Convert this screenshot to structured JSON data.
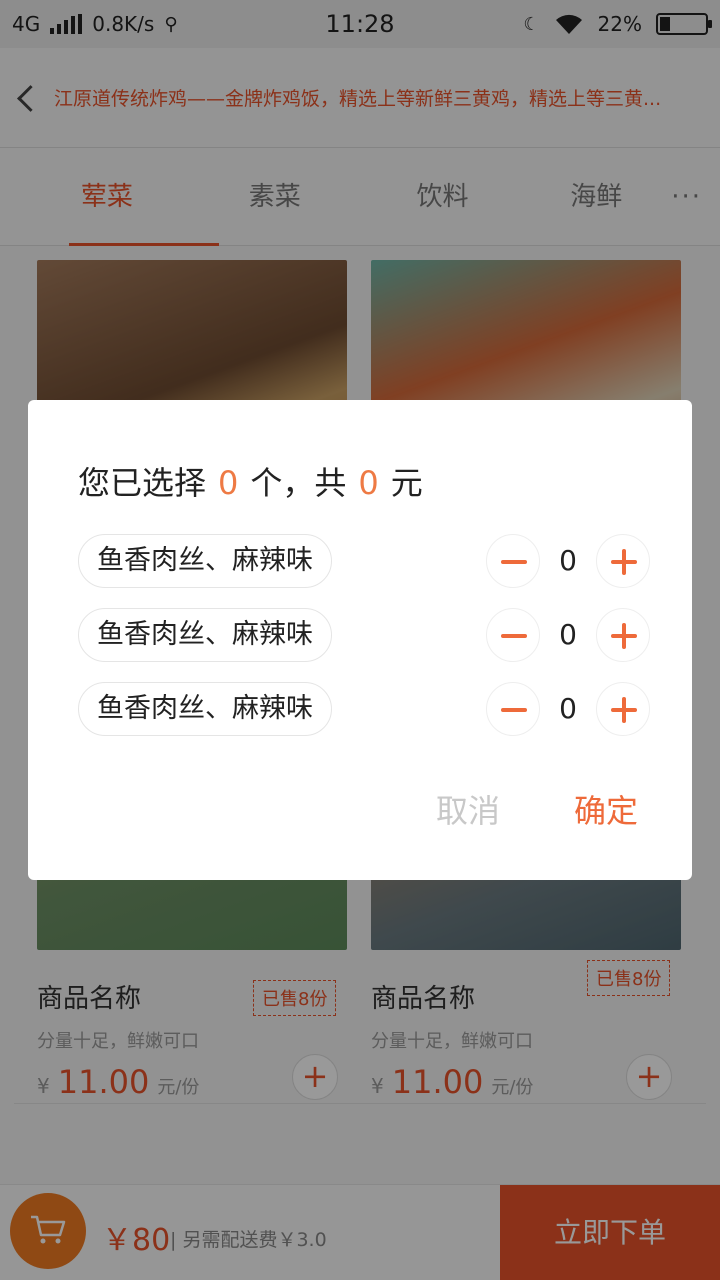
{
  "status_bar": {
    "network": "4G",
    "speed": "0.8K/s",
    "time": "11:28",
    "battery": "22%",
    "battery_level": 0.22
  },
  "header": {
    "title": "江原道传统炸鸡——金牌炸鸡饭，精选上等新鲜三黄鸡，精选上等三黄..."
  },
  "tabs": {
    "items": [
      {
        "label": "荤菜",
        "active": true
      },
      {
        "label": "素菜",
        "active": false
      },
      {
        "label": "饮料",
        "active": false
      },
      {
        "label": "海鲜",
        "active": false
      }
    ],
    "more": "···"
  },
  "products": [
    {
      "name": "商品名称",
      "sold": "已售8份",
      "desc": "分量十足，鲜嫩可口",
      "currency": "¥",
      "price": "11.00",
      "unit": "元/份",
      "add": "+"
    },
    {
      "name": "商品名称",
      "sold": "已售8份",
      "desc": "分量十足，鲜嫩可口",
      "currency": "¥",
      "price": "11.00",
      "unit": "元/份",
      "add": "+"
    }
  ],
  "bottom_bar": {
    "total": "￥80",
    "fee": "| 另需配送费￥3.0",
    "order_button": "立即下单"
  },
  "dialog": {
    "title_prefix": "您已选择",
    "count": "0",
    "title_mid": "个，共",
    "amount": "0",
    "title_suffix": "元",
    "options": [
      {
        "label": "鱼香肉丝、麻辣味",
        "qty": "0"
      },
      {
        "label": "鱼香肉丝、麻辣味",
        "qty": "0"
      },
      {
        "label": "鱼香肉丝、麻辣味",
        "qty": "0"
      }
    ],
    "cancel": "取消",
    "confirm": "确定"
  },
  "colors": {
    "accent": "#e8532b",
    "cart": "#ee7a22"
  }
}
